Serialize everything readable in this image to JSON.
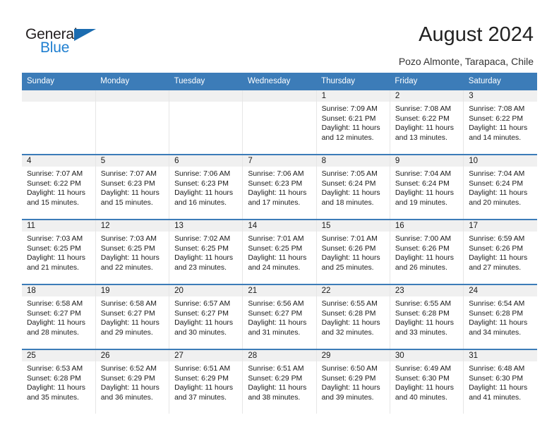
{
  "brand": {
    "name_part1": "General",
    "name_part2": "Blue"
  },
  "header": {
    "title": "August 2024",
    "subtitle": "Pozo Almonte, Tarapaca, Chile"
  },
  "colors": {
    "header_blue": "#3c7cb8",
    "brand_blue": "#1f7fd0",
    "daynum_band": "#f0f0f0",
    "cell_border": "#e6e6e6"
  },
  "weekday_headers": [
    "Sunday",
    "Monday",
    "Tuesday",
    "Wednesday",
    "Thursday",
    "Friday",
    "Saturday"
  ],
  "labels": {
    "sunrise_prefix": "Sunrise:",
    "sunset_prefix": "Sunset:",
    "daylight_prefix": "Daylight:"
  },
  "weeks": [
    [
      {
        "day": "",
        "sunrise": "",
        "sunset": "",
        "daylight_line1": "",
        "daylight_line2": "",
        "empty": true
      },
      {
        "day": "",
        "sunrise": "",
        "sunset": "",
        "daylight_line1": "",
        "daylight_line2": "",
        "empty": true
      },
      {
        "day": "",
        "sunrise": "",
        "sunset": "",
        "daylight_line1": "",
        "daylight_line2": "",
        "empty": true
      },
      {
        "day": "",
        "sunrise": "",
        "sunset": "",
        "daylight_line1": "",
        "daylight_line2": "",
        "empty": true
      },
      {
        "day": "1",
        "sunrise": "Sunrise: 7:09 AM",
        "sunset": "Sunset: 6:21 PM",
        "daylight_line1": "Daylight: 11 hours",
        "daylight_line2": "and 12 minutes.",
        "empty": false
      },
      {
        "day": "2",
        "sunrise": "Sunrise: 7:08 AM",
        "sunset": "Sunset: 6:22 PM",
        "daylight_line1": "Daylight: 11 hours",
        "daylight_line2": "and 13 minutes.",
        "empty": false
      },
      {
        "day": "3",
        "sunrise": "Sunrise: 7:08 AM",
        "sunset": "Sunset: 6:22 PM",
        "daylight_line1": "Daylight: 11 hours",
        "daylight_line2": "and 14 minutes.",
        "empty": false
      }
    ],
    [
      {
        "day": "4",
        "sunrise": "Sunrise: 7:07 AM",
        "sunset": "Sunset: 6:22 PM",
        "daylight_line1": "Daylight: 11 hours",
        "daylight_line2": "and 15 minutes.",
        "empty": false
      },
      {
        "day": "5",
        "sunrise": "Sunrise: 7:07 AM",
        "sunset": "Sunset: 6:23 PM",
        "daylight_line1": "Daylight: 11 hours",
        "daylight_line2": "and 15 minutes.",
        "empty": false
      },
      {
        "day": "6",
        "sunrise": "Sunrise: 7:06 AM",
        "sunset": "Sunset: 6:23 PM",
        "daylight_line1": "Daylight: 11 hours",
        "daylight_line2": "and 16 minutes.",
        "empty": false
      },
      {
        "day": "7",
        "sunrise": "Sunrise: 7:06 AM",
        "sunset": "Sunset: 6:23 PM",
        "daylight_line1": "Daylight: 11 hours",
        "daylight_line2": "and 17 minutes.",
        "empty": false
      },
      {
        "day": "8",
        "sunrise": "Sunrise: 7:05 AM",
        "sunset": "Sunset: 6:24 PM",
        "daylight_line1": "Daylight: 11 hours",
        "daylight_line2": "and 18 minutes.",
        "empty": false
      },
      {
        "day": "9",
        "sunrise": "Sunrise: 7:04 AM",
        "sunset": "Sunset: 6:24 PM",
        "daylight_line1": "Daylight: 11 hours",
        "daylight_line2": "and 19 minutes.",
        "empty": false
      },
      {
        "day": "10",
        "sunrise": "Sunrise: 7:04 AM",
        "sunset": "Sunset: 6:24 PM",
        "daylight_line1": "Daylight: 11 hours",
        "daylight_line2": "and 20 minutes.",
        "empty": false
      }
    ],
    [
      {
        "day": "11",
        "sunrise": "Sunrise: 7:03 AM",
        "sunset": "Sunset: 6:25 PM",
        "daylight_line1": "Daylight: 11 hours",
        "daylight_line2": "and 21 minutes.",
        "empty": false
      },
      {
        "day": "12",
        "sunrise": "Sunrise: 7:03 AM",
        "sunset": "Sunset: 6:25 PM",
        "daylight_line1": "Daylight: 11 hours",
        "daylight_line2": "and 22 minutes.",
        "empty": false
      },
      {
        "day": "13",
        "sunrise": "Sunrise: 7:02 AM",
        "sunset": "Sunset: 6:25 PM",
        "daylight_line1": "Daylight: 11 hours",
        "daylight_line2": "and 23 minutes.",
        "empty": false
      },
      {
        "day": "14",
        "sunrise": "Sunrise: 7:01 AM",
        "sunset": "Sunset: 6:25 PM",
        "daylight_line1": "Daylight: 11 hours",
        "daylight_line2": "and 24 minutes.",
        "empty": false
      },
      {
        "day": "15",
        "sunrise": "Sunrise: 7:01 AM",
        "sunset": "Sunset: 6:26 PM",
        "daylight_line1": "Daylight: 11 hours",
        "daylight_line2": "and 25 minutes.",
        "empty": false
      },
      {
        "day": "16",
        "sunrise": "Sunrise: 7:00 AM",
        "sunset": "Sunset: 6:26 PM",
        "daylight_line1": "Daylight: 11 hours",
        "daylight_line2": "and 26 minutes.",
        "empty": false
      },
      {
        "day": "17",
        "sunrise": "Sunrise: 6:59 AM",
        "sunset": "Sunset: 6:26 PM",
        "daylight_line1": "Daylight: 11 hours",
        "daylight_line2": "and 27 minutes.",
        "empty": false
      }
    ],
    [
      {
        "day": "18",
        "sunrise": "Sunrise: 6:58 AM",
        "sunset": "Sunset: 6:27 PM",
        "daylight_line1": "Daylight: 11 hours",
        "daylight_line2": "and 28 minutes.",
        "empty": false
      },
      {
        "day": "19",
        "sunrise": "Sunrise: 6:58 AM",
        "sunset": "Sunset: 6:27 PM",
        "daylight_line1": "Daylight: 11 hours",
        "daylight_line2": "and 29 minutes.",
        "empty": false
      },
      {
        "day": "20",
        "sunrise": "Sunrise: 6:57 AM",
        "sunset": "Sunset: 6:27 PM",
        "daylight_line1": "Daylight: 11 hours",
        "daylight_line2": "and 30 minutes.",
        "empty": false
      },
      {
        "day": "21",
        "sunrise": "Sunrise: 6:56 AM",
        "sunset": "Sunset: 6:27 PM",
        "daylight_line1": "Daylight: 11 hours",
        "daylight_line2": "and 31 minutes.",
        "empty": false
      },
      {
        "day": "22",
        "sunrise": "Sunrise: 6:55 AM",
        "sunset": "Sunset: 6:28 PM",
        "daylight_line1": "Daylight: 11 hours",
        "daylight_line2": "and 32 minutes.",
        "empty": false
      },
      {
        "day": "23",
        "sunrise": "Sunrise: 6:55 AM",
        "sunset": "Sunset: 6:28 PM",
        "daylight_line1": "Daylight: 11 hours",
        "daylight_line2": "and 33 minutes.",
        "empty": false
      },
      {
        "day": "24",
        "sunrise": "Sunrise: 6:54 AM",
        "sunset": "Sunset: 6:28 PM",
        "daylight_line1": "Daylight: 11 hours",
        "daylight_line2": "and 34 minutes.",
        "empty": false
      }
    ],
    [
      {
        "day": "25",
        "sunrise": "Sunrise: 6:53 AM",
        "sunset": "Sunset: 6:28 PM",
        "daylight_line1": "Daylight: 11 hours",
        "daylight_line2": "and 35 minutes.",
        "empty": false
      },
      {
        "day": "26",
        "sunrise": "Sunrise: 6:52 AM",
        "sunset": "Sunset: 6:29 PM",
        "daylight_line1": "Daylight: 11 hours",
        "daylight_line2": "and 36 minutes.",
        "empty": false
      },
      {
        "day": "27",
        "sunrise": "Sunrise: 6:51 AM",
        "sunset": "Sunset: 6:29 PM",
        "daylight_line1": "Daylight: 11 hours",
        "daylight_line2": "and 37 minutes.",
        "empty": false
      },
      {
        "day": "28",
        "sunrise": "Sunrise: 6:51 AM",
        "sunset": "Sunset: 6:29 PM",
        "daylight_line1": "Daylight: 11 hours",
        "daylight_line2": "and 38 minutes.",
        "empty": false
      },
      {
        "day": "29",
        "sunrise": "Sunrise: 6:50 AM",
        "sunset": "Sunset: 6:29 PM",
        "daylight_line1": "Daylight: 11 hours",
        "daylight_line2": "and 39 minutes.",
        "empty": false
      },
      {
        "day": "30",
        "sunrise": "Sunrise: 6:49 AM",
        "sunset": "Sunset: 6:30 PM",
        "daylight_line1": "Daylight: 11 hours",
        "daylight_line2": "and 40 minutes.",
        "empty": false
      },
      {
        "day": "31",
        "sunrise": "Sunrise: 6:48 AM",
        "sunset": "Sunset: 6:30 PM",
        "daylight_line1": "Daylight: 11 hours",
        "daylight_line2": "and 41 minutes.",
        "empty": false
      }
    ]
  ]
}
